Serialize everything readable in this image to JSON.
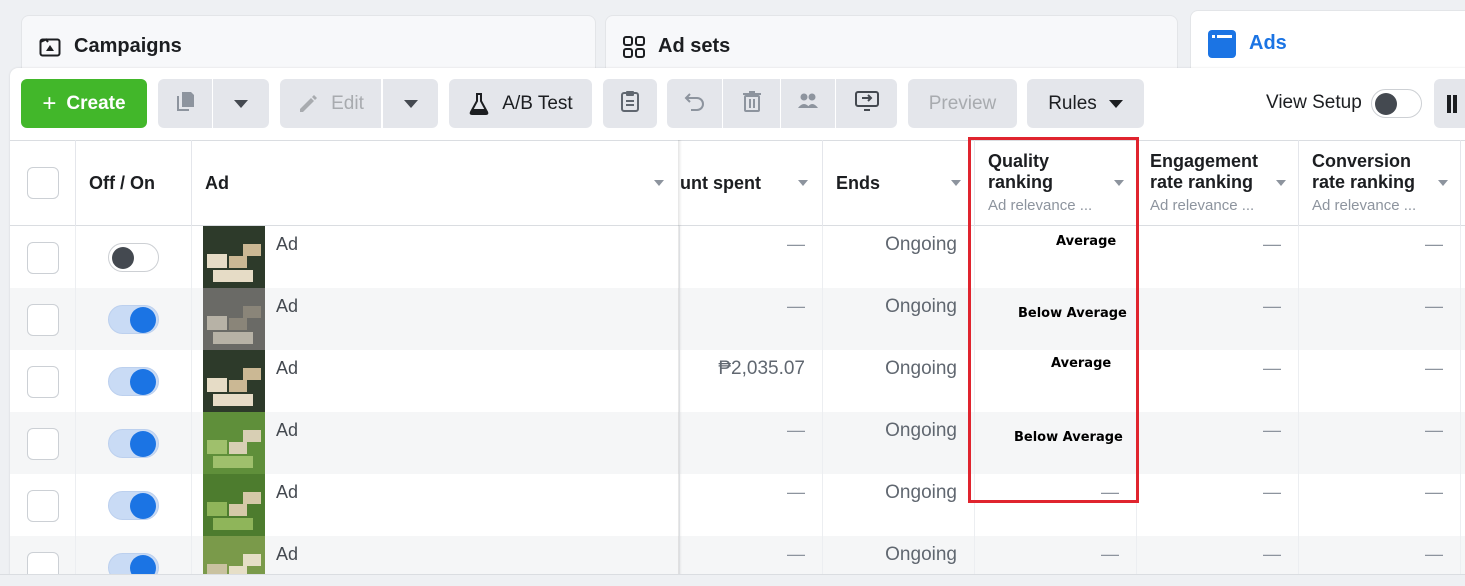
{
  "tabs": [
    {
      "label": "Campaigns",
      "icon": "campaign-icon"
    },
    {
      "label": "Ad sets",
      "icon": "grid-icon"
    },
    {
      "label": "Ads",
      "icon": "ad-window-icon",
      "active": true
    }
  ],
  "toolbar": {
    "create_label": "Create",
    "edit_label": "Edit",
    "ab_test_label": "A/B Test",
    "preview_label": "Preview",
    "rules_label": "Rules",
    "view_setup_label": "View Setup"
  },
  "columns": {
    "off_on": "Off / On",
    "ad": "Ad",
    "amount_spent": "unt spent",
    "ends": "Ends",
    "quality_title": "Quality ranking",
    "quality_sub": "Ad relevance ...",
    "engagement_title": "Engagement rate ranking",
    "engagement_sub": "Ad relevance ...",
    "conversion_title": "Conversion rate ranking",
    "conversion_sub": "Ad relevance ..."
  },
  "rows": [
    {
      "toggle": "off",
      "name": "Ad",
      "spent": "—",
      "ends": "Ongoing",
      "quality": "Average",
      "engagement": "—",
      "conversion": "—"
    },
    {
      "toggle": "on",
      "name": "Ad",
      "spent": "—",
      "ends": "Ongoing",
      "quality": "Below Average",
      "engagement": "—",
      "conversion": "—"
    },
    {
      "toggle": "on",
      "name": "Ad",
      "spent": "₱2,035.07",
      "ends": "Ongoing",
      "quality": "Average",
      "engagement": "—",
      "conversion": "—"
    },
    {
      "toggle": "on",
      "name": "Ad",
      "spent": "—",
      "ends": "Ongoing",
      "quality": "Below Average",
      "engagement": "—",
      "conversion": "—"
    },
    {
      "toggle": "on",
      "name": "Ad",
      "spent": "—",
      "ends": "Ongoing",
      "quality": "—",
      "engagement": "—",
      "conversion": "—"
    },
    {
      "toggle": "on",
      "name": "Ad",
      "spent": "—",
      "ends": "Ongoing",
      "quality": "—",
      "engagement": "—",
      "conversion": "—"
    }
  ],
  "colors": {
    "accent_blue": "#1b74e4",
    "create_green": "#42b72a",
    "highlight_red": "#e0242e"
  }
}
